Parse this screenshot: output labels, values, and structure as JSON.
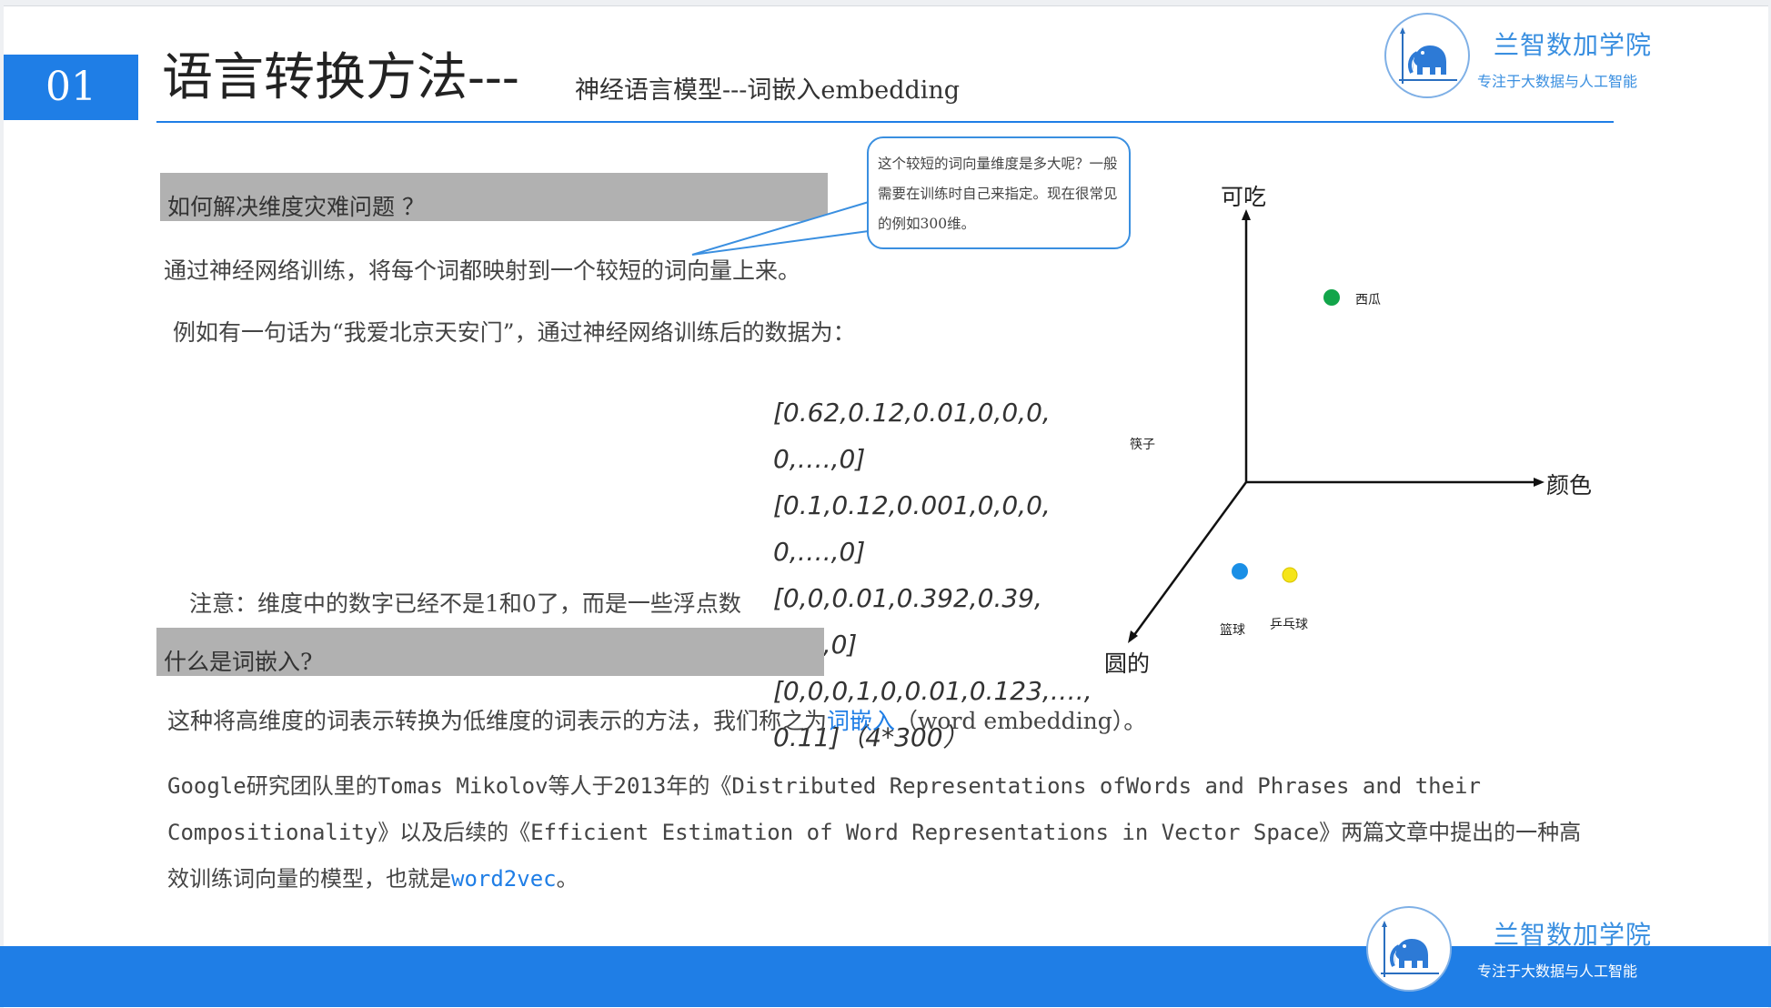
{
  "slide": {
    "number": "01",
    "title_main": "语言转换方法---",
    "title_sub": "神经语言模型---词嵌入embedding"
  },
  "brand": {
    "name": "兰智数加学院",
    "tagline": "专注于大数据与人工智能",
    "logo_icon": "elephant-icon"
  },
  "section1": {
    "heading": "如何解决维度灾难问题 ？",
    "line1": "通过神经网络训练，将每个词都映射到一个较短的词向量上来。",
    "line2": "例如有一句话为“我爱北京天安门”，通过神经网络训练后的数据为：",
    "note": "注意：维度中的数字已经不是1和0了，而是一些浮点数"
  },
  "callout": {
    "text": "这个较短的词向量维度是多大呢？一般需要在训练时自己来指定。现在很常见的例如300维。"
  },
  "vectors": {
    "lines": [
      "[0.62,0.12,0.01,0,0,0,",
      "0,….,0]",
      "[0.1,0.12,0.001,0,0,0,",
      "0,….,0]",
      "[0,0,0.01,0.392,0.39,",
      "0….,0]",
      "[0,0,0,1,0,0.01,0.123,….,",
      "0.11]（4*300）"
    ]
  },
  "section2": {
    "heading": "什么是词嵌入?",
    "line_prefix": "这种将高维度的词表示转换为低维度的词表示的方法，我们称之为",
    "term": "词嵌入",
    "line_suffix": "（word embedding）。",
    "para_line1": "Google研究团队里的Tomas Mikolov等人于2013年的《Distributed Representations ofWords and Phrases and their",
    "para_line2": "Compositionality》以及后续的《Efficient Estimation of Word Representations in Vector Space》两篇文章中提出的一种高",
    "para_line3_prefix": "效训练词向量的模型，也就是",
    "para_line3_term": "word2vec",
    "para_line3_suffix": "。"
  },
  "diagram": {
    "axis_y": "可吃",
    "axis_x": "颜色",
    "axis_z": "圆的",
    "points": [
      {
        "label": "西瓜",
        "color": "#12a54a"
      },
      {
        "label": "筷子",
        "color": ""
      },
      {
        "label": "篮球",
        "color": "#1a8fe6"
      },
      {
        "label": "乒乓球",
        "color": "#f5e51a"
      }
    ]
  },
  "colors": {
    "accent": "#1f7ee6",
    "heading_bar": "#b1b1b1"
  }
}
